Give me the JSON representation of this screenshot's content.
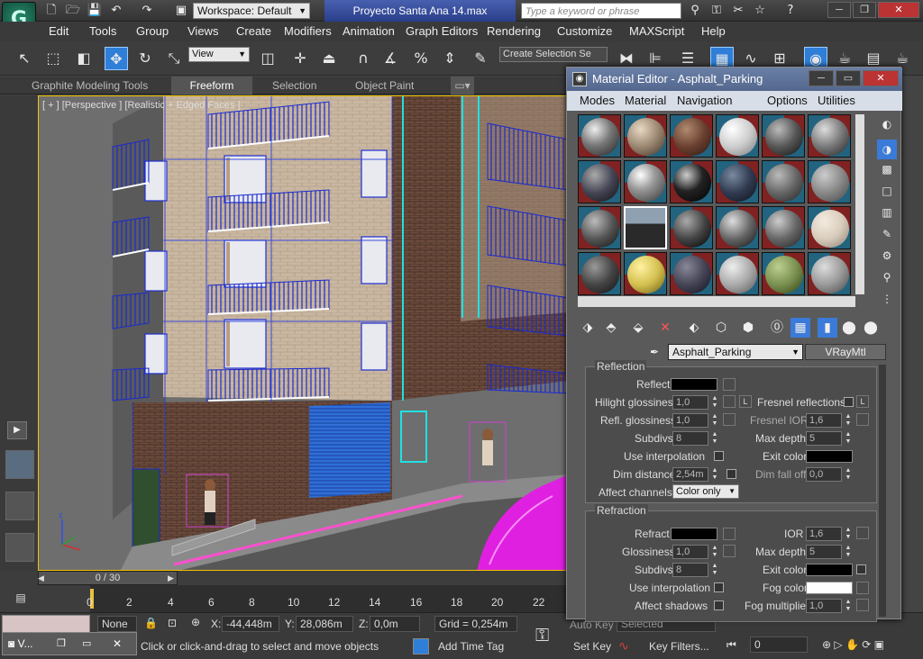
{
  "app": {
    "logo_glyph": "G",
    "workspace": "Workspace: Default",
    "doc_title": "Proyecto Santa Ana 14.max",
    "search_placeholder": "Type a keyword or phrase"
  },
  "menu": [
    "Edit",
    "Tools",
    "Group",
    "Views",
    "Create",
    "Modifiers",
    "Animation",
    "Graph Editors",
    "Rendering",
    "Customize",
    "MAXScript",
    "Help"
  ],
  "toolbar": {
    "view_dropdown": "View",
    "selection_set": "Create Selection Se"
  },
  "ribbon": {
    "tabs": [
      "Graphite Modeling Tools",
      "Freeform",
      "Selection",
      "Object Paint"
    ],
    "active": "Freeform"
  },
  "viewport": {
    "label": "[ + ] [Perspective ] [Realistic + Edged Faces ]"
  },
  "timeline": {
    "slider": "0 / 30",
    "ticks": [
      "0",
      "2",
      "4",
      "6",
      "8",
      "10",
      "12",
      "14",
      "16",
      "18",
      "20",
      "22"
    ]
  },
  "status": {
    "selection": "None Se",
    "x_label": "X:",
    "x_value": "-44,448m",
    "y_label": "Y:",
    "y_value": "28,086m",
    "z_label": "Z:",
    "z_value": "0,0m",
    "grid": "Grid = 0,254m",
    "prompt": "Click or click-and-drag to select and move objects",
    "add_time_tag": "Add Time Tag",
    "auto_key": "Auto Key",
    "selected": "Selected",
    "set_key": "Set Key",
    "key_filters": "Key Filters...",
    "frame": "0",
    "taskbar": "V..."
  },
  "material_editor": {
    "title": "Material Editor - Asphalt_Parking",
    "menu": [
      "Modes",
      "Material",
      "Navigation",
      "Options",
      "Utilities"
    ],
    "material_name": "Asphalt_Parking",
    "material_type": "VRayMtl",
    "reflection": {
      "title": "Reflection",
      "reflect": "Reflect",
      "hilight_glossiness": "Hilight glossiness",
      "hilight_value": "1,0",
      "l_btn": "L",
      "fresnel": "Fresnel reflections",
      "refl_glossiness": "Refl. glossiness",
      "refl_value": "1,0",
      "fresnel_ior": "Fresnel IOR",
      "fresnel_ior_value": "1,6",
      "subdivs": "Subdivs",
      "subdivs_value": "8",
      "max_depth": "Max depth",
      "max_depth_value": "5",
      "use_interp": "Use interpolation",
      "exit_color": "Exit color",
      "dim_distance": "Dim distance",
      "dim_value": "2,54m",
      "dim_falloff": "Dim fall off",
      "dim_falloff_value": "0,0",
      "affect_channels": "Affect channels",
      "affect_value": "Color only"
    },
    "refraction": {
      "title": "Refraction",
      "refract": "Refract",
      "ior": "IOR",
      "ior_value": "1,6",
      "glossiness": "Glossiness",
      "gloss_value": "1,0",
      "max_depth": "Max depth",
      "max_depth_value": "5",
      "subdivs": "Subdivs",
      "subdivs_value": "8",
      "exit_color": "Exit color",
      "use_interp": "Use interpolation",
      "fog_color": "Fog color",
      "affect_shadows": "Affect shadows",
      "fog_multiplier": "Fog multiplier",
      "fog_mult_value": "1,0"
    }
  }
}
